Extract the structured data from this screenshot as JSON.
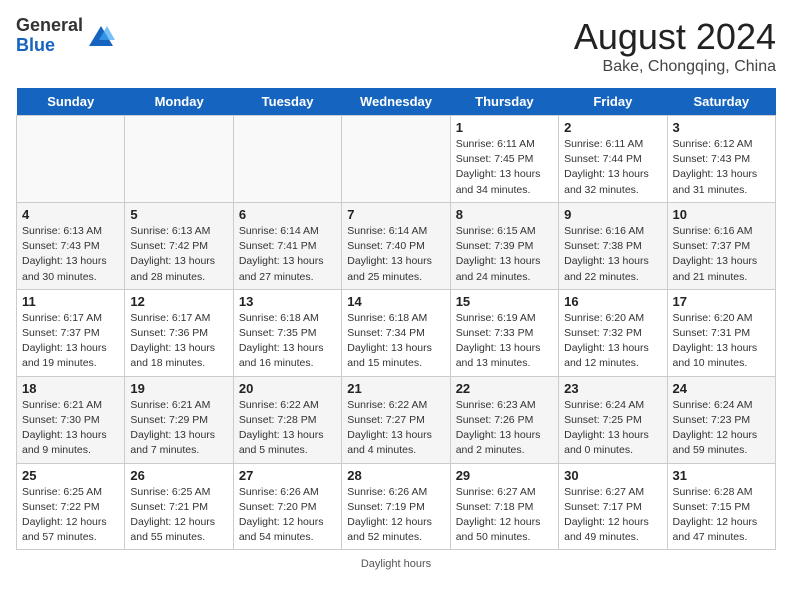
{
  "header": {
    "logo_general": "General",
    "logo_blue": "Blue",
    "month_year": "August 2024",
    "location": "Bake, Chongqing, China"
  },
  "days_of_week": [
    "Sunday",
    "Monday",
    "Tuesday",
    "Wednesday",
    "Thursday",
    "Friday",
    "Saturday"
  ],
  "weeks": [
    [
      {
        "day": "",
        "info": ""
      },
      {
        "day": "",
        "info": ""
      },
      {
        "day": "",
        "info": ""
      },
      {
        "day": "",
        "info": ""
      },
      {
        "day": "1",
        "info": "Sunrise: 6:11 AM\nSunset: 7:45 PM\nDaylight: 13 hours and 34 minutes."
      },
      {
        "day": "2",
        "info": "Sunrise: 6:11 AM\nSunset: 7:44 PM\nDaylight: 13 hours and 32 minutes."
      },
      {
        "day": "3",
        "info": "Sunrise: 6:12 AM\nSunset: 7:43 PM\nDaylight: 13 hours and 31 minutes."
      }
    ],
    [
      {
        "day": "4",
        "info": "Sunrise: 6:13 AM\nSunset: 7:43 PM\nDaylight: 13 hours and 30 minutes."
      },
      {
        "day": "5",
        "info": "Sunrise: 6:13 AM\nSunset: 7:42 PM\nDaylight: 13 hours and 28 minutes."
      },
      {
        "day": "6",
        "info": "Sunrise: 6:14 AM\nSunset: 7:41 PM\nDaylight: 13 hours and 27 minutes."
      },
      {
        "day": "7",
        "info": "Sunrise: 6:14 AM\nSunset: 7:40 PM\nDaylight: 13 hours and 25 minutes."
      },
      {
        "day": "8",
        "info": "Sunrise: 6:15 AM\nSunset: 7:39 PM\nDaylight: 13 hours and 24 minutes."
      },
      {
        "day": "9",
        "info": "Sunrise: 6:16 AM\nSunset: 7:38 PM\nDaylight: 13 hours and 22 minutes."
      },
      {
        "day": "10",
        "info": "Sunrise: 6:16 AM\nSunset: 7:37 PM\nDaylight: 13 hours and 21 minutes."
      }
    ],
    [
      {
        "day": "11",
        "info": "Sunrise: 6:17 AM\nSunset: 7:37 PM\nDaylight: 13 hours and 19 minutes."
      },
      {
        "day": "12",
        "info": "Sunrise: 6:17 AM\nSunset: 7:36 PM\nDaylight: 13 hours and 18 minutes."
      },
      {
        "day": "13",
        "info": "Sunrise: 6:18 AM\nSunset: 7:35 PM\nDaylight: 13 hours and 16 minutes."
      },
      {
        "day": "14",
        "info": "Sunrise: 6:18 AM\nSunset: 7:34 PM\nDaylight: 13 hours and 15 minutes."
      },
      {
        "day": "15",
        "info": "Sunrise: 6:19 AM\nSunset: 7:33 PM\nDaylight: 13 hours and 13 minutes."
      },
      {
        "day": "16",
        "info": "Sunrise: 6:20 AM\nSunset: 7:32 PM\nDaylight: 13 hours and 12 minutes."
      },
      {
        "day": "17",
        "info": "Sunrise: 6:20 AM\nSunset: 7:31 PM\nDaylight: 13 hours and 10 minutes."
      }
    ],
    [
      {
        "day": "18",
        "info": "Sunrise: 6:21 AM\nSunset: 7:30 PM\nDaylight: 13 hours and 9 minutes."
      },
      {
        "day": "19",
        "info": "Sunrise: 6:21 AM\nSunset: 7:29 PM\nDaylight: 13 hours and 7 minutes."
      },
      {
        "day": "20",
        "info": "Sunrise: 6:22 AM\nSunset: 7:28 PM\nDaylight: 13 hours and 5 minutes."
      },
      {
        "day": "21",
        "info": "Sunrise: 6:22 AM\nSunset: 7:27 PM\nDaylight: 13 hours and 4 minutes."
      },
      {
        "day": "22",
        "info": "Sunrise: 6:23 AM\nSunset: 7:26 PM\nDaylight: 13 hours and 2 minutes."
      },
      {
        "day": "23",
        "info": "Sunrise: 6:24 AM\nSunset: 7:25 PM\nDaylight: 13 hours and 0 minutes."
      },
      {
        "day": "24",
        "info": "Sunrise: 6:24 AM\nSunset: 7:23 PM\nDaylight: 12 hours and 59 minutes."
      }
    ],
    [
      {
        "day": "25",
        "info": "Sunrise: 6:25 AM\nSunset: 7:22 PM\nDaylight: 12 hours and 57 minutes."
      },
      {
        "day": "26",
        "info": "Sunrise: 6:25 AM\nSunset: 7:21 PM\nDaylight: 12 hours and 55 minutes."
      },
      {
        "day": "27",
        "info": "Sunrise: 6:26 AM\nSunset: 7:20 PM\nDaylight: 12 hours and 54 minutes."
      },
      {
        "day": "28",
        "info": "Sunrise: 6:26 AM\nSunset: 7:19 PM\nDaylight: 12 hours and 52 minutes."
      },
      {
        "day": "29",
        "info": "Sunrise: 6:27 AM\nSunset: 7:18 PM\nDaylight: 12 hours and 50 minutes."
      },
      {
        "day": "30",
        "info": "Sunrise: 6:27 AM\nSunset: 7:17 PM\nDaylight: 12 hours and 49 minutes."
      },
      {
        "day": "31",
        "info": "Sunrise: 6:28 AM\nSunset: 7:15 PM\nDaylight: 12 hours and 47 minutes."
      }
    ]
  ],
  "footer": {
    "daylight_label": "Daylight hours"
  }
}
